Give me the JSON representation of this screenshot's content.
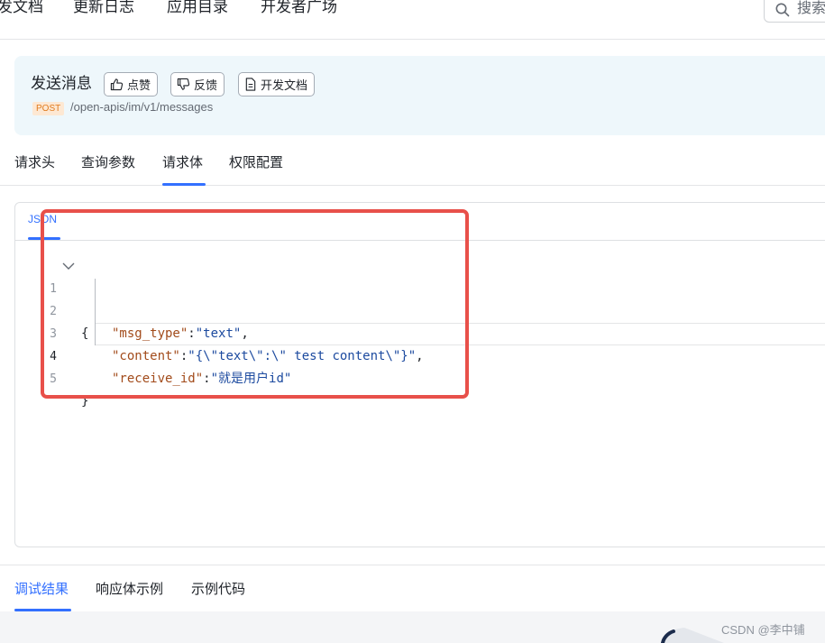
{
  "topnav": {
    "items": [
      {
        "label": "发文档"
      },
      {
        "label": "更新日志"
      },
      {
        "label": "应用目录"
      },
      {
        "label": "开发者广场"
      }
    ],
    "search_placeholder": "搜索"
  },
  "api": {
    "title": "发送消息",
    "like_label": "点赞",
    "feedback_label": "反馈",
    "docs_label": "开发文档",
    "method": "POST",
    "path": "/open-apis/im/v1/messages"
  },
  "request_tabs": [
    {
      "label": "请求头"
    },
    {
      "label": "查询参数"
    },
    {
      "label": "请求体",
      "active": true
    },
    {
      "label": "权限配置"
    }
  ],
  "editor": {
    "tab_label": "JSON",
    "lines": [
      {
        "no": "1",
        "open": "{"
      },
      {
        "no": "2",
        "key": "\"msg_type\"",
        "sep": ":",
        "value": "\"text\"",
        "end": ","
      },
      {
        "no": "3",
        "key": "\"content\"",
        "sep": ":",
        "value": "\"{\\\"text\\\":\\\" test content\\\"}\"",
        "end": ","
      },
      {
        "no": "4",
        "key": "\"receive_id\"",
        "sep": ":",
        "value": "\"就是用户id\"",
        "end": ""
      },
      {
        "no": "5",
        "close": "}"
      }
    ]
  },
  "result_tabs": [
    {
      "label": "调试结果",
      "active": true
    },
    {
      "label": "响应体示例"
    },
    {
      "label": "示例代码"
    }
  ],
  "watermark": "CSDN @李中铺",
  "colors": {
    "accent": "#3370ff",
    "annotation": "#e8504a",
    "header_bg": "#eef7fb",
    "badge_bg": "#fde8d3",
    "badge_text": "#e07b1d"
  },
  "icons": {
    "search": "search-icon",
    "like": "thumbs-up-icon",
    "feedback": "thumbs-down-icon",
    "docs": "document-icon",
    "fold": "chevron-down-icon"
  }
}
